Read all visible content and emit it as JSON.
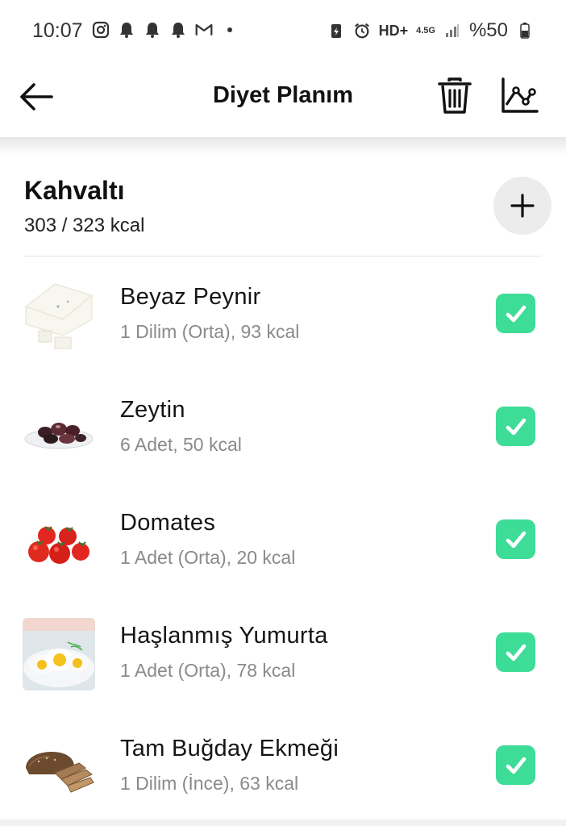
{
  "status_bar": {
    "time": "10:07",
    "battery": "%50",
    "left_icons": [
      "instagram-icon",
      "bell-icon",
      "bell-icon",
      "bell-icon",
      "gmail-icon",
      "dot-icon"
    ],
    "right_icons": [
      "battery-saver-icon",
      "alarm-icon",
      "hd-plus-icon",
      "4-5g-icon",
      "signal-icon",
      "battery-icon"
    ],
    "network_label": "HD+",
    "network_type": "4.5G"
  },
  "app_bar": {
    "title": "Diyet Planım",
    "back_icon": "arrow-left-icon",
    "delete_icon": "trash-icon",
    "stats_icon": "line-chart-icon"
  },
  "meal": {
    "title": "Kahvaltı",
    "kcal": "303 / 323 kcal",
    "add_icon": "plus-icon"
  },
  "foods": [
    {
      "name": "Beyaz Peynir",
      "detail": "1 Dilim (Orta), 93 kcal",
      "checked": true,
      "image": "white-cheese"
    },
    {
      "name": "Zeytin",
      "detail": "6 Adet, 50 kcal",
      "checked": true,
      "image": "olives"
    },
    {
      "name": "Domates",
      "detail": "1 Adet (Orta), 20 kcal",
      "checked": true,
      "image": "tomatoes"
    },
    {
      "name": "Haşlanmış Yumurta",
      "detail": "1 Adet (Orta), 78 kcal",
      "checked": true,
      "image": "boiled-egg"
    },
    {
      "name": "Tam Buğday Ekmeği",
      "detail": "1 Dilim (İnce), 63 kcal",
      "checked": true,
      "image": "whole-wheat-bread"
    }
  ],
  "colors": {
    "accent_check": "#3ddc97",
    "add_button_bg": "#ececec",
    "detail_text": "#8a8a8a"
  }
}
